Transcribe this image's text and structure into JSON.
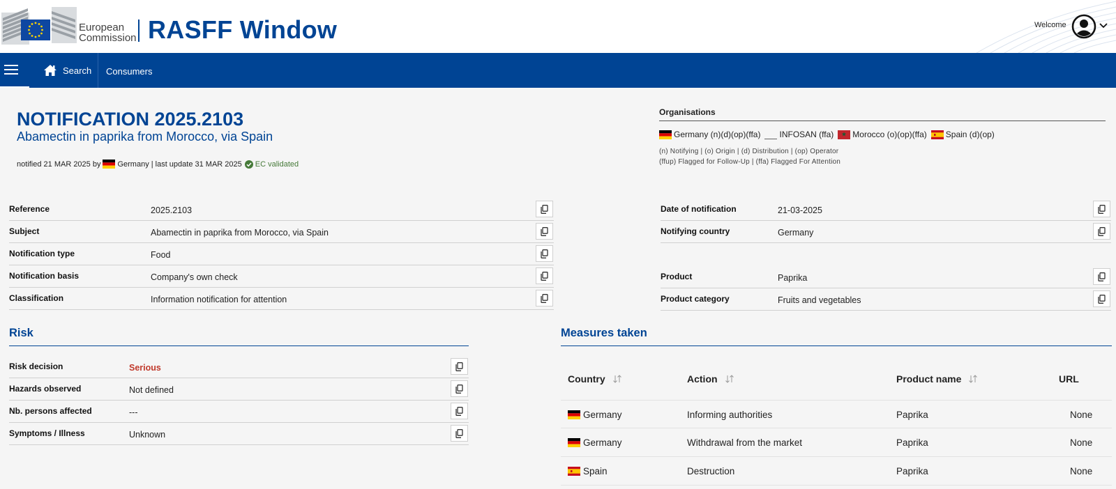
{
  "header": {
    "logo_text_line1": "European",
    "logo_text_line2": "Commission",
    "app_title": "RASFF Window",
    "welcome": "Welcome"
  },
  "nav": {
    "search": "Search",
    "consumers": "Consumers"
  },
  "notification": {
    "title": "NOTIFICATION 2025.2103",
    "subtitle": "Abamectin in paprika from Morocco, via Spain",
    "meta_prefix": "notified 21 MAR 2025 by",
    "meta_country": "Germany",
    "meta_suffix": "| last update 31 MAR 2025",
    "validated": "EC validated"
  },
  "organisations": {
    "title": "Organisations",
    "items": [
      {
        "flag": "de",
        "label": "Germany (n)(d)(op)(ffa)"
      },
      {
        "flag": "none",
        "label": "INFOSAN (ffa)"
      },
      {
        "flag": "ma",
        "label": "Morocco (o)(op)(ffa)"
      },
      {
        "flag": "es",
        "label": "Spain (d)(op)"
      }
    ],
    "legend_line1": "(n) Notifying | (o) Origin | (d) Distribution | (op) Operator",
    "legend_line2": "(ffup) Flagged for Follow-Up | (ffa) Flagged For Attention"
  },
  "details_left": [
    {
      "label": "Reference",
      "value": "2025.2103"
    },
    {
      "label": "Subject",
      "value": "Abamectin in paprika from Morocco, via Spain"
    },
    {
      "label": "Notification type",
      "value": "Food"
    },
    {
      "label": "Notification basis",
      "value": "Company's own check"
    },
    {
      "label": "Classification",
      "value": "Information notification for attention"
    }
  ],
  "details_right": [
    {
      "label": "Date of notification",
      "value": "21-03-2025"
    },
    {
      "label": "Notifying country",
      "value": "Germany"
    },
    {
      "label": "Product",
      "value": "Paprika"
    },
    {
      "label": "Product category",
      "value": "Fruits and vegetables"
    }
  ],
  "risk": {
    "title": "Risk",
    "rows": [
      {
        "label": "Risk decision",
        "value": "Serious"
      },
      {
        "label": "Hazards observed",
        "value": "Not defined"
      },
      {
        "label": "Nb. persons affected",
        "value": "---"
      },
      {
        "label": "Symptoms / Illness",
        "value": "Unknown"
      }
    ]
  },
  "measures": {
    "title": "Measures taken",
    "headers": {
      "country": "Country",
      "action": "Action",
      "product_name": "Product name",
      "url": "URL"
    },
    "rows": [
      {
        "flag": "de",
        "country": "Germany",
        "action": "Informing authorities",
        "product_name": "Paprika",
        "url": "None"
      },
      {
        "flag": "de",
        "country": "Germany",
        "action": "Withdrawal from the market",
        "product_name": "Paprika",
        "url": "None"
      },
      {
        "flag": "es",
        "country": "Spain",
        "action": "Destruction",
        "product_name": "Paprika",
        "url": "None"
      }
    ]
  },
  "colors": {
    "brand_blue": "#004494",
    "serious_red": "#c0392b",
    "validated_green": "#467a39"
  }
}
